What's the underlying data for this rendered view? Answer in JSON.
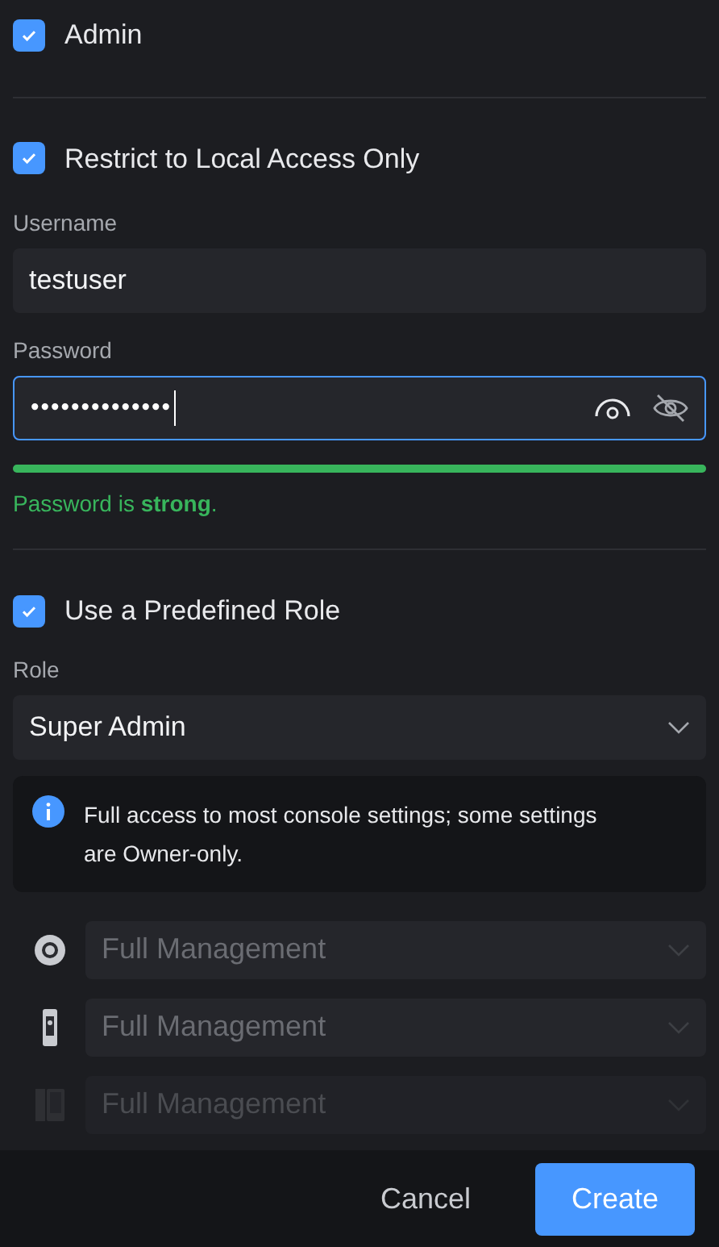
{
  "admin": {
    "label": "Admin",
    "checked": true
  },
  "restrict": {
    "label": "Restrict to Local Access Only",
    "checked": true
  },
  "username": {
    "label": "Username",
    "value": "testuser"
  },
  "password": {
    "label": "Password",
    "value": "••••••••••••••",
    "focused": true,
    "strength": {
      "level": 1,
      "message": "Password is **strong**."
    }
  },
  "predefined": {
    "label": "Use a Predefined Role",
    "checked": true
  },
  "role": {
    "label": "Role",
    "value": "Super Admin",
    "info": "Full access to most console settings; some settings are Owner-only."
  },
  "apps": [
    {
      "kind": "camera",
      "value": "Full Management",
      "faded": false
    },
    {
      "kind": "doorbell",
      "value": "Full Management",
      "faded": false
    },
    {
      "kind": "panel",
      "value": "Full Management",
      "faded": true
    }
  ],
  "buttons": {
    "cancel": "Cancel",
    "create": "Create"
  }
}
